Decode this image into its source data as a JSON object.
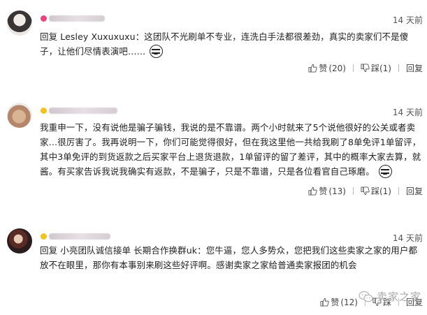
{
  "comments": [
    {
      "timestamp": "14 天前",
      "text": "回复 Lesley Xuxuxuxu：这团队不光刷单不专业，连洗白手法都很差劲，真实的卖家们不是傻子，让他们尽情表演吧……",
      "likes": "(20)",
      "dislike_label": "踩(1)",
      "reply_label": "回复",
      "like_label": "赞"
    },
    {
      "timestamp": "14 天前",
      "text": "我重申一下，没有说他是骗子骗钱，我说的是不靠谱。两个小时就来了5个说他很好的公关或者卖家…很厉害了。我再说明一下，你们可能觉得很好，但在我这里他一共给我刷了8单免评1单留评，其中3单免评的到货返款之后买家平台上退货退款，1单留评的留了差评，其中的概率大家去算，就酱。有买家告诉我说我确实有返款，不是骗子，只是不靠谱，只是各位看官自己琢磨。",
      "likes": "(13)",
      "dislike_label": "踩(1)",
      "reply_label": "回复",
      "like_label": "赞"
    },
    {
      "timestamp": "14 天前",
      "text": "回复 小亮团队诚信接单 长期合作换群uk：您牛逼，您人多势众，您把我们这些卖家之家的用户都放不在眼里，那你有本事别来刷这些好评啊。感谢卖家之家给普通卖家报团的机会",
      "likes": "(12)",
      "dislike_label": "踩",
      "reply_label": "回复",
      "like_label": "赞"
    }
  ],
  "watermark": "卖家之家",
  "icons": [
    "thumbs-up-icon",
    "thumbs-down-icon",
    "face-emoji-icon",
    "wechat-icon"
  ],
  "colors": {
    "badge_pink": "#e8457a",
    "badge_gold": "#f2c21d",
    "text": "#222222",
    "meta": "#555555"
  }
}
